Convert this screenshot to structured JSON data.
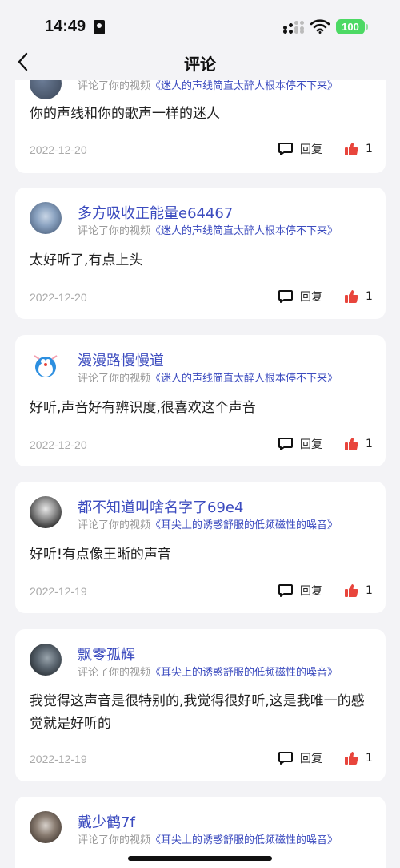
{
  "status_bar": {
    "time": "14:49",
    "battery": "100"
  },
  "nav": {
    "title": "评论"
  },
  "meta_prefix": "评论了你的视频",
  "reply_label": "回复",
  "comments": [
    {
      "user": "",
      "video": "《迷人的声线简直太醉人根本停不下来》",
      "text": "你的声线和你的歌声一样的迷人",
      "date": "2022-12-20",
      "likes": "1"
    },
    {
      "user": "多方吸收正能量e64467",
      "video": "《迷人的声线简直太醉人根本停不下来》",
      "text": "太好听了,有点上头",
      "date": "2022-12-20",
      "likes": "1"
    },
    {
      "user": "漫漫路慢慢道",
      "video": "《迷人的声线简直太醉人根本停不下来》",
      "text": "好听,声音好有辨识度,很喜欢这个声音",
      "date": "2022-12-20",
      "likes": "1"
    },
    {
      "user": "都不知道叫啥名字了69e4",
      "video": "《耳尖上的诱惑舒服的低频磁性的噪音》",
      "text": "好听!有点像王晰的声音",
      "date": "2022-12-19",
      "likes": "1"
    },
    {
      "user": "飘零孤辉",
      "video": "《耳尖上的诱惑舒服的低频磁性的噪音》",
      "text": "我觉得这声音是很特别的,我觉得很好听,这是我唯一的感觉就是好听的",
      "date": "2022-12-19",
      "likes": "1"
    },
    {
      "user": "戴少鹤7f",
      "video": "《耳尖上的诱惑舒服的低频磁性的噪音》",
      "text": "",
      "date": "",
      "likes": ""
    }
  ],
  "colors": {
    "accent": "#3b4bbf",
    "like": "#e8453c",
    "battery": "#4cd964"
  }
}
